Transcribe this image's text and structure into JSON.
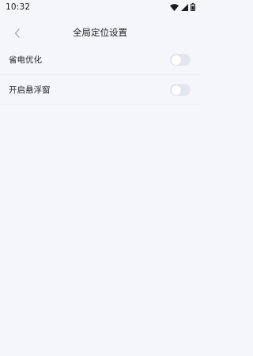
{
  "status_bar": {
    "time": "10:32",
    "icons": [
      "wifi-icon",
      "signal-icon",
      "battery-icon"
    ]
  },
  "header": {
    "title": "全局定位设置",
    "back_icon": "chevron-left-icon"
  },
  "settings": [
    {
      "label": "省电优化",
      "enabled": false
    },
    {
      "label": "开启悬浮窗",
      "enabled": false
    }
  ],
  "colors": {
    "background": "#f5f6fa",
    "toggle_off_track": "#e3e6ee",
    "toggle_knob": "#ffffff",
    "divider": "#eceef3"
  }
}
